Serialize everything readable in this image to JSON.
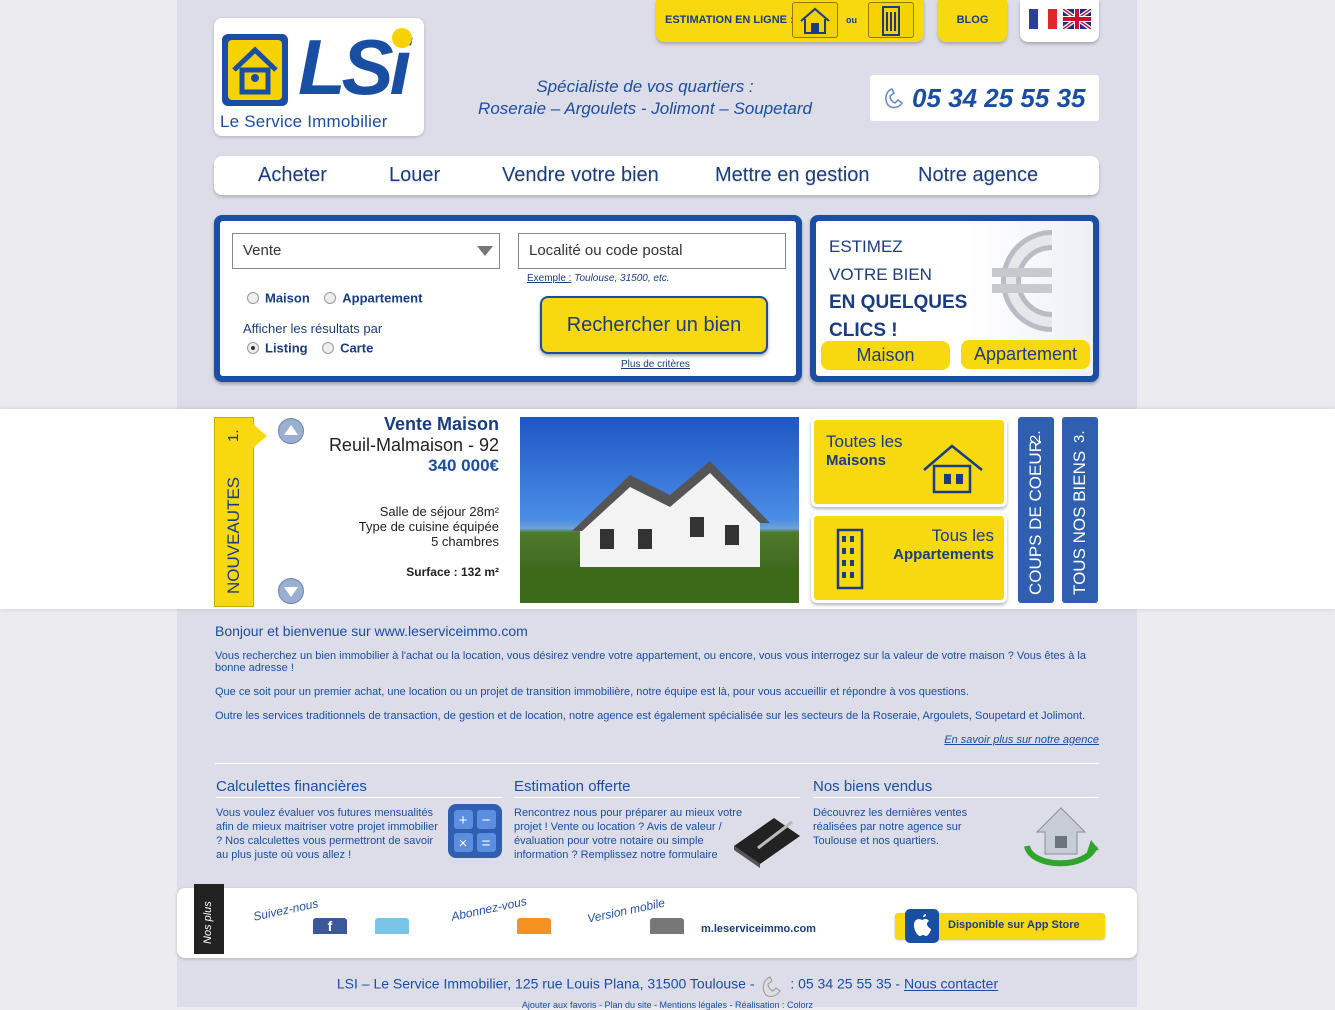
{
  "header": {
    "logo_text": "LSi",
    "logo_sub": "Le Service Immobilier",
    "estimation_label": "ESTIMATION EN LIGNE :",
    "or_label": "ou",
    "blog_label": "BLOG",
    "tagline_1": "Spécialiste de vos quartiers :",
    "tagline_2": "Roseraie – Argoulets - Jolimont – Soupetard",
    "phone": "05 34 25 55 35"
  },
  "nav": {
    "items": [
      "Acheter",
      "Louer",
      "Vendre votre bien",
      "Mettre en gestion",
      "Notre agence"
    ]
  },
  "search": {
    "transaction_value": "Vente",
    "location_placeholder": "Localité ou code postal",
    "example_label": "Exemple :",
    "example_value": "Toulouse, 31500, etc.",
    "type_maison": "Maison",
    "type_appartement": "Appartement",
    "display_label": "Afficher les résultats par",
    "display_listing": "Listing",
    "display_carte": "Carte",
    "submit_label": "Rechercher un bien",
    "more_criteria": "Plus de critères"
  },
  "estimate": {
    "line1": "ESTIMEZ",
    "line2": "VOTRE BIEN",
    "line3": "EN QUELQUES",
    "line4": "CLICS !",
    "btn_maison": "Maison",
    "btn_appartement": "Appartement"
  },
  "featured": {
    "tab_label": "NOUVEAUTES",
    "tab_num": "1.",
    "title": "Vente Maison",
    "location": "Reuil-Malmaison - 92",
    "price": "340 000€",
    "feature_1": "Salle de séjour 28m²",
    "feature_2": "Type de cuisine équipée",
    "feature_3": "5 chambres",
    "surface": "Surface : 132 m²"
  },
  "categories": {
    "maisons_1": "Toutes les",
    "maisons_2": "Maisons",
    "apparts_1": "Tous les",
    "apparts_2": "Appartements"
  },
  "side_tabs": {
    "coups": "COUPS DE COEUR",
    "coups_num": "2.",
    "tous": "TOUS NOS BIENS",
    "tous_num": "3."
  },
  "welcome": {
    "title": "Bonjour et bienvenue sur www.leserviceimmo.com",
    "p1": "Vous recherchez un bien immobilier à l'achat ou la location, vous désirez vendre votre appartement, ou encore, vous vous interrogez sur la valeur de votre maison ? Vous êtes à la bonne adresse !",
    "p2": "Que ce soit pour un premier achat, une location ou un projet de transition immobilière, notre équipe est là, pour vous accueillir et répondre à vos questions.",
    "p3": "Outre les services traditionnels de transaction, de gestion et de location, notre agence est également spécialisée sur les secteurs de la Roseraie, Argoulets, Soupetard et Jolimont.",
    "more_link": "En savoir plus sur notre agence"
  },
  "services": [
    {
      "title": "Calculettes financières",
      "text": "Vous voulez évaluer vos futures mensualités afin de mieux maitriser votre projet immobilier ? Nos calculettes vous permettront de savoir au plus juste où vous allez !"
    },
    {
      "title": "Estimation offerte",
      "text": "Rencontrez nous pour préparer au mieux votre projet ! Vente ou location ? Avis de valeur /évaluation pour votre notaire ou simple information ? Remplissez notre formulaire"
    },
    {
      "title": "Nos biens vendus",
      "text": "Découvrez les dernières ventes réalisées par notre agence sur Toulouse et nos quartiers."
    }
  ],
  "social": {
    "nos_plus": "Nos plus",
    "follow": "Suivez-nous",
    "subscribe": "Abonnez-vous",
    "mobile": "Version mobile",
    "mobile_url": "m.leserviceimmo.com",
    "app_store": "Disponible sur App Store"
  },
  "footer": {
    "address": "LSI – Le Service Immobilier, 125 rue Louis Plana, 31500 Toulouse  -",
    "phone": ": 05 34 25 55 35 -",
    "contact": "Nous contacter",
    "mini": "Ajouter aux favoris - Plan du site - Mentions légales - Réalisation : Colorz"
  },
  "colors": {
    "brand_blue": "#1a4ea3",
    "brand_yellow": "#f8d90f"
  }
}
